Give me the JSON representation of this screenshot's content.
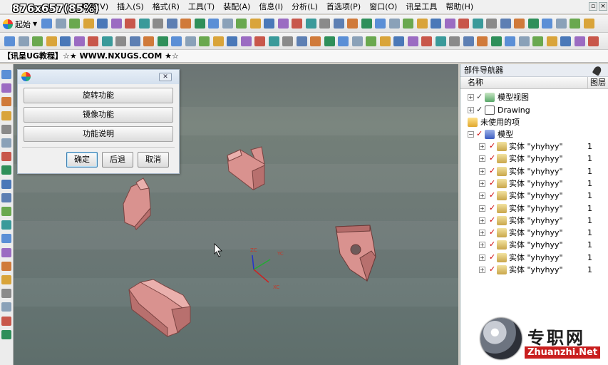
{
  "menubar": {
    "size_label": "876x657(85%)",
    "items": [
      "视图(V)",
      "插入(S)",
      "格式(R)",
      "工具(T)",
      "装配(A)",
      "信息(I)",
      "分析(L)",
      "首选项(P)",
      "窗口(O)",
      "讯呈工具",
      "帮助(H)"
    ]
  },
  "toolbar": {
    "start_label": "起始"
  },
  "info_bar": {
    "text": "【讯呈UG教程】☆★ WWW.NXUGS.COM ★☆"
  },
  "dialog": {
    "functions": [
      "旋转功能",
      "镜像功能",
      "功能说明"
    ],
    "ok_label": "确定",
    "back_label": "后退",
    "cancel_label": "取消"
  },
  "viewport": {
    "axis_labels": {
      "zc": "ZC",
      "xc": "XC",
      "yc": "YC"
    }
  },
  "part_navigator": {
    "title": "部件导航器",
    "col_name": "名称",
    "col_layer": "图层",
    "nodes": {
      "model_views": "模型视图",
      "drawing": "Drawing",
      "unused": "未使用的项",
      "model": "模型"
    },
    "bodies": [
      {
        "label": "实体 \"yhyhyy\"",
        "layer": "1"
      },
      {
        "label": "实体 \"yhyhyy\"",
        "layer": "1"
      },
      {
        "label": "实体 \"yhyhyy\"",
        "layer": "1"
      },
      {
        "label": "实体 \"yhyhyy\"",
        "layer": "1"
      },
      {
        "label": "实体 \"yhyhyy\"",
        "layer": "1"
      },
      {
        "label": "实体 \"yhyhyy\"",
        "layer": "1"
      },
      {
        "label": "实体 \"yhyhyy\"",
        "layer": "1"
      },
      {
        "label": "实体 \"yhyhyy\"",
        "layer": "1"
      },
      {
        "label": "实体 \"yhyhyy\"",
        "layer": "1"
      },
      {
        "label": "实体 \"yhyhyy\"",
        "layer": "1"
      },
      {
        "label": "实体 \"yhyhyy\"",
        "layer": "1"
      }
    ]
  },
  "watermark": {
    "cn": "专职网",
    "en": "Zhuanzhi.Net"
  },
  "colors": {
    "part": "#d9928f",
    "part_edge": "#8a4c4a",
    "viewport": "#6f7b77"
  }
}
